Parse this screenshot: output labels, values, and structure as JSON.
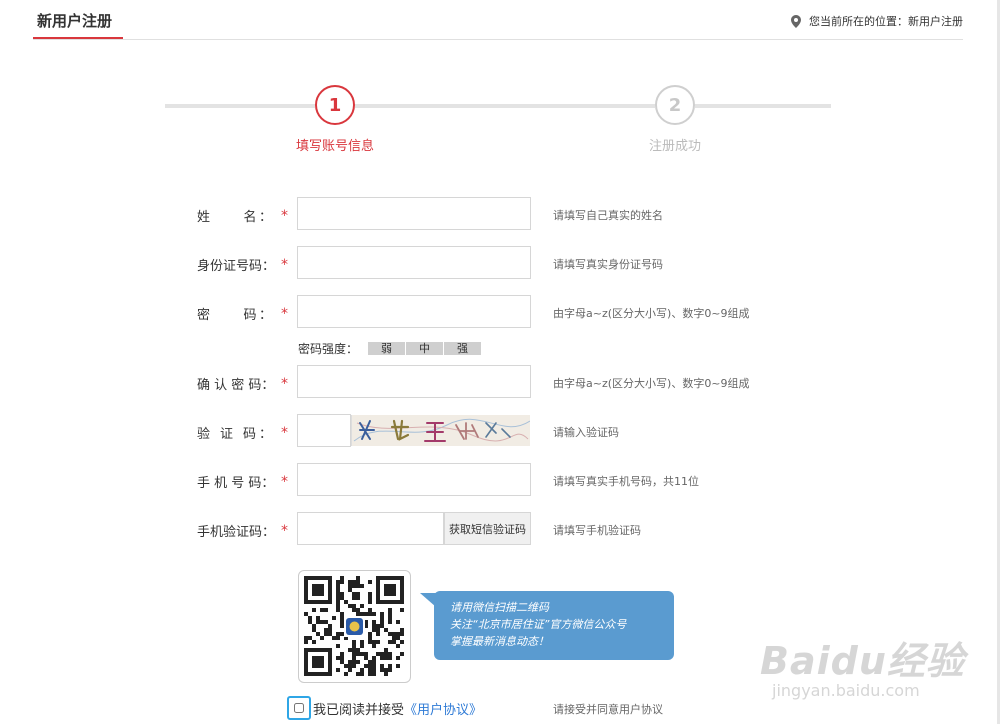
{
  "header": {
    "title": "新用户注册",
    "location_text": "您当前所在的位置：新用户注册"
  },
  "steps": [
    {
      "number": "1",
      "label": "填写账号信息",
      "state": "active"
    },
    {
      "number": "2",
      "label": "注册成功",
      "state": "inactive"
    }
  ],
  "form": {
    "required_mark": "*",
    "name": {
      "label": "姓　　名：",
      "value": "",
      "hint": "请填写自己真实的姓名"
    },
    "id_number": {
      "label": "身份证号码：",
      "value": "",
      "hint": "请填写真实身份证号码"
    },
    "password": {
      "label": "密　　码：",
      "value": "",
      "hint": "由字母a~z(区分大小写)、数字0~9组成"
    },
    "password_strength": {
      "label": "密码强度：",
      "levels": [
        "弱",
        "中",
        "强"
      ]
    },
    "confirm_password": {
      "label": "确 认 密 码：",
      "value": "",
      "hint": "由字母a~z(区分大小写)、数字0~9组成"
    },
    "captcha": {
      "label": "验 证 码：",
      "value": "",
      "hint": "请输入验证码"
    },
    "phone": {
      "label": "手 机 号 码：",
      "value": "",
      "hint": "请填写真实手机号码，共11位"
    },
    "sms_code": {
      "label": "手机验证码：",
      "value": "",
      "button": "获取短信验证码",
      "hint": "请填写手机验证码"
    }
  },
  "wechat": {
    "line1": "请用微信扫描二维码",
    "line2": "关注“北京市居住证”官方微信公众号",
    "line3": "掌握最新消息动态！"
  },
  "agreement": {
    "text": "我已阅读并接受",
    "link": "《用户协议》",
    "hint": "请接受并同意用户协议",
    "checked": false
  },
  "watermark": {
    "main": "Baidu经验",
    "sub": "jingyan.baidu.com"
  },
  "colors": {
    "accent": "#d9373d",
    "link": "#2f7bd6",
    "bubble": "#5a9bd0",
    "focus": "#2fa6e6"
  }
}
